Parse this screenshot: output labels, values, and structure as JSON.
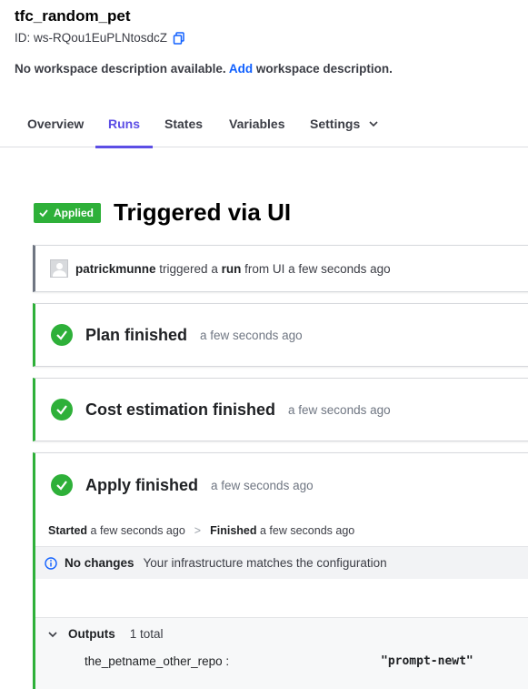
{
  "workspace": {
    "name": "tfc_random_pet",
    "id_label": "ID: ws-RQou1EuPLNtosdcZ",
    "description": {
      "prefix": "No workspace description available.",
      "link": "Add",
      "suffix": "workspace description."
    }
  },
  "tabs": [
    {
      "label": "Overview"
    },
    {
      "label": "Runs"
    },
    {
      "label": "States"
    },
    {
      "label": "Variables"
    },
    {
      "label": "Settings"
    }
  ],
  "active_tab": "Runs",
  "run": {
    "status_badge": "Applied",
    "title": "Triggered via UI",
    "trigger": {
      "user": "patrickmunne",
      "text1": " triggered a ",
      "run_word": "run",
      "text2": " from UI a few seconds ago"
    }
  },
  "steps": [
    {
      "title": "Plan finished",
      "time": "a few seconds ago"
    },
    {
      "title": "Cost estimation finished",
      "time": "a few seconds ago"
    },
    {
      "title": "Apply finished",
      "time": "a few seconds ago"
    }
  ],
  "apply": {
    "started_label": "Started",
    "started_time": " a few seconds ago",
    "arrow": ">",
    "finished_label": "Finished",
    "finished_time": " a few seconds ago",
    "no_changes": "No changes",
    "no_changes_text": "Your infrastructure matches the configuration",
    "outputs_label": "Outputs",
    "outputs_count": "1 total",
    "output_name": "the_petname_other_repo :",
    "output_value": "\"prompt-newt\""
  },
  "colors": {
    "accent": "#5c4ee5",
    "success": "#2eb039",
    "link": "#1060ff"
  },
  "icons": {
    "copy": "copy-icon",
    "chevron": "chevron-down-icon",
    "check": "check-circle-icon",
    "info": "info-icon",
    "avatar": "avatar"
  }
}
